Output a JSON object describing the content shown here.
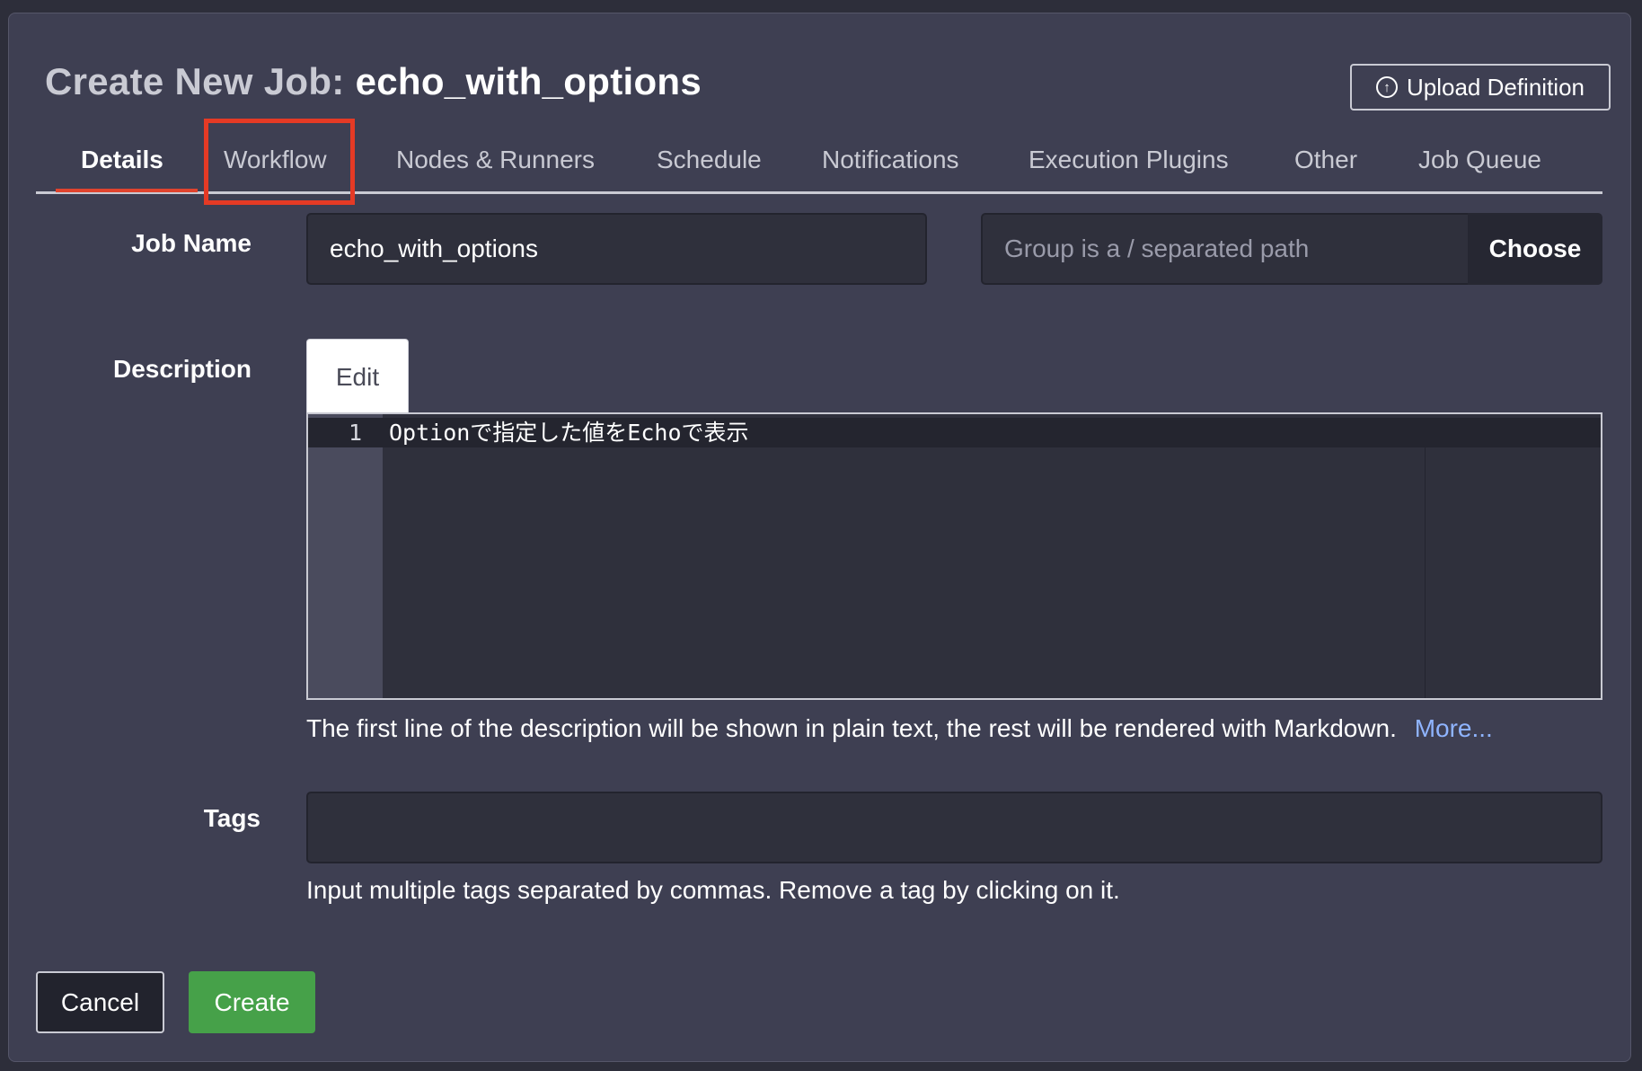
{
  "header": {
    "title_prefix": "Create New Job:",
    "job_name": "echo_with_options",
    "upload_label": "Upload Definition"
  },
  "tabs": [
    {
      "label": "Details",
      "active": true
    },
    {
      "label": "Workflow",
      "active": false
    },
    {
      "label": "Nodes & Runners",
      "active": false
    },
    {
      "label": "Schedule",
      "active": false
    },
    {
      "label": "Notifications",
      "active": false
    },
    {
      "label": "Execution Plugins",
      "active": false
    },
    {
      "label": "Other",
      "active": false
    },
    {
      "label": "Job Queue",
      "active": false
    }
  ],
  "form": {
    "job_name_label": "Job Name",
    "job_name_value": "echo_with_options",
    "group_placeholder": "Group is a / separated path",
    "choose_label": "Choose",
    "description_label": "Description",
    "edit_tab_label": "Edit",
    "editor": {
      "line_number": "1",
      "line_text": "Optionで指定した値をEchoで表示"
    },
    "description_help": "The first line of the description will be shown in plain text, the rest will be rendered with Markdown.",
    "more_link": "More...",
    "tags_label": "Tags",
    "tags_value": "",
    "tags_help": "Input multiple tags separated by commas. Remove a tag by clicking on it."
  },
  "footer": {
    "cancel_label": "Cancel",
    "create_label": "Create"
  },
  "colors": {
    "background": "#2d2e3a",
    "panel": "#3e3f52",
    "accent_red": "#e53a25",
    "create_green": "#46a149",
    "link_blue": "#8fb4ff"
  }
}
